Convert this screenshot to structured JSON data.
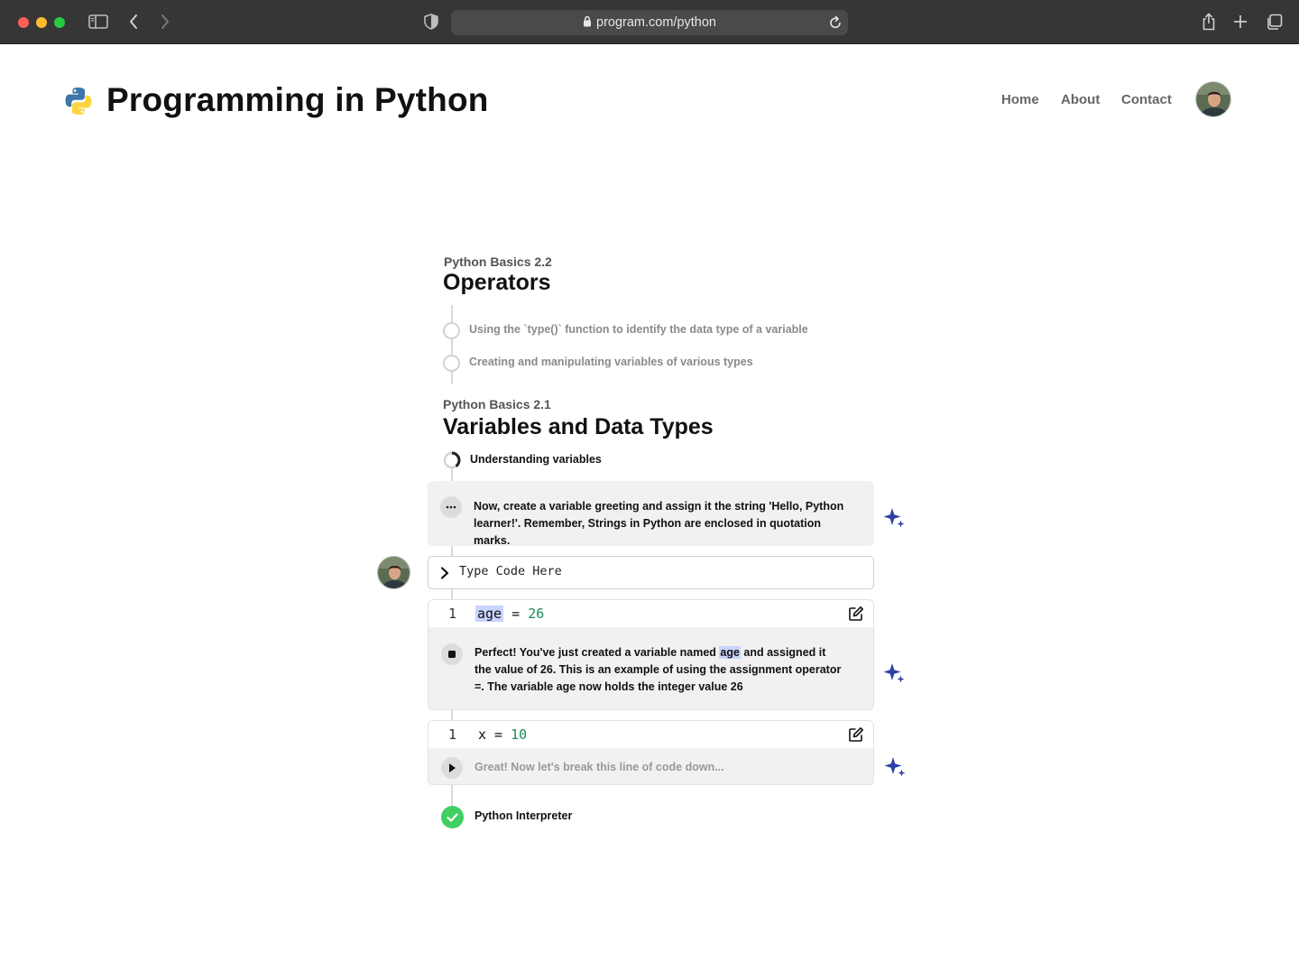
{
  "browser": {
    "url": "program.com/python"
  },
  "site": {
    "title": "Programming in Python",
    "nav": [
      "Home",
      "About",
      "Contact"
    ]
  },
  "lessons": [
    {
      "kicker": "Python Basics 2.2",
      "title": "Operators",
      "topics": [
        "Using the `type()` function to identify the data type of a variable",
        "Creating and manipulating variables of various types"
      ]
    },
    {
      "kicker": "Python Basics 2.1",
      "title": "Variables and Data Types",
      "topic_current": "Understanding variables",
      "topic_done": "Python Interpreter"
    }
  ],
  "prompt_card": {
    "text": "Now, create a variable greeting and assign it the string 'Hello, Python learner!'. Remember, Strings in Python are enclosed in quotation marks."
  },
  "code_input": {
    "placeholder": "Type Code Here"
  },
  "code_block_1": {
    "line_number": "1",
    "var": "age",
    "op": " = ",
    "value": "26",
    "feedback_before": "Perfect! You've just created a variable named ",
    "feedback_highlight": "age",
    "feedback_after": " and assigned it the value of 26. This is an example of using the assignment operator =. The variable age now holds the integer value 26"
  },
  "code_block_2": {
    "line_number": "1",
    "var": "x",
    "op": " = ",
    "value": "10",
    "feedback": "Great! Now let's break this line of code down..."
  },
  "colors": {
    "accent_sparkle": "#2f3fa8",
    "success": "#3fcf63",
    "highlight": "#c9d4ff",
    "number": "#1a8a5a"
  }
}
